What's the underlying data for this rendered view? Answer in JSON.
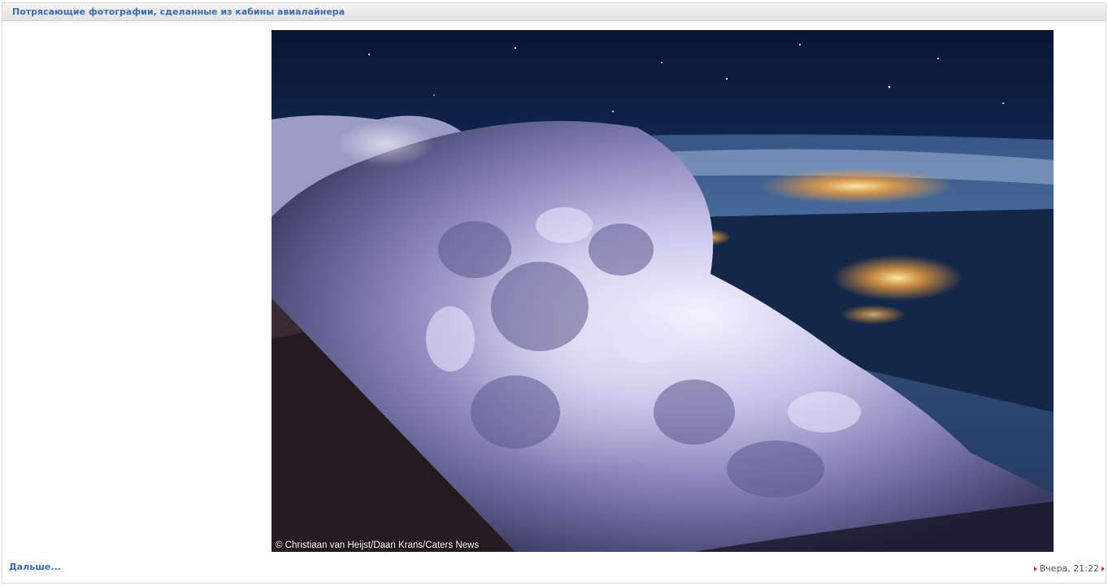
{
  "post": {
    "title": "Потрясающие фотографии, сделанные из кабины авиалайнера",
    "photo_caption": "© Christiaan van Heijst/Daan Krans/Caters News",
    "more_link": "Дальше...",
    "date": "Вчера, 21:22"
  },
  "colors": {
    "link": "#3a6cb6",
    "arrow": "#c0392b"
  }
}
